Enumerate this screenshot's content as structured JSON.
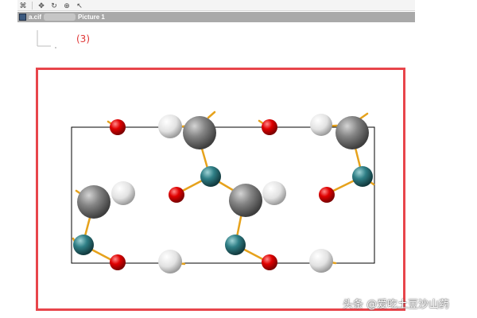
{
  "toolbar": {
    "buttons": [
      {
        "icon": "crosshair-icon",
        "glyph": "⌘"
      },
      {
        "icon": "move-icon",
        "glyph": "✥"
      },
      {
        "icon": "rotate-icon",
        "glyph": "↻"
      },
      {
        "icon": "zoom-icon",
        "glyph": "⊕"
      },
      {
        "icon": "select-icon",
        "glyph": "↖"
      }
    ]
  },
  "window": {
    "file_name": "a.cif",
    "picture_title": "Picture 1"
  },
  "annotation": {
    "label": "(3)"
  },
  "colors": {
    "frame": "#e8454b",
    "label": "#e03535",
    "oxygen": "#e00000",
    "hydrogen": "#e6e6e6",
    "metal_gray": "#7a7a7a",
    "metal_teal": "#2f7f86",
    "bond": "#e6a21c",
    "cell": "#000000"
  },
  "watermark": {
    "text": "头条 @爱吃土豆沙山药"
  }
}
